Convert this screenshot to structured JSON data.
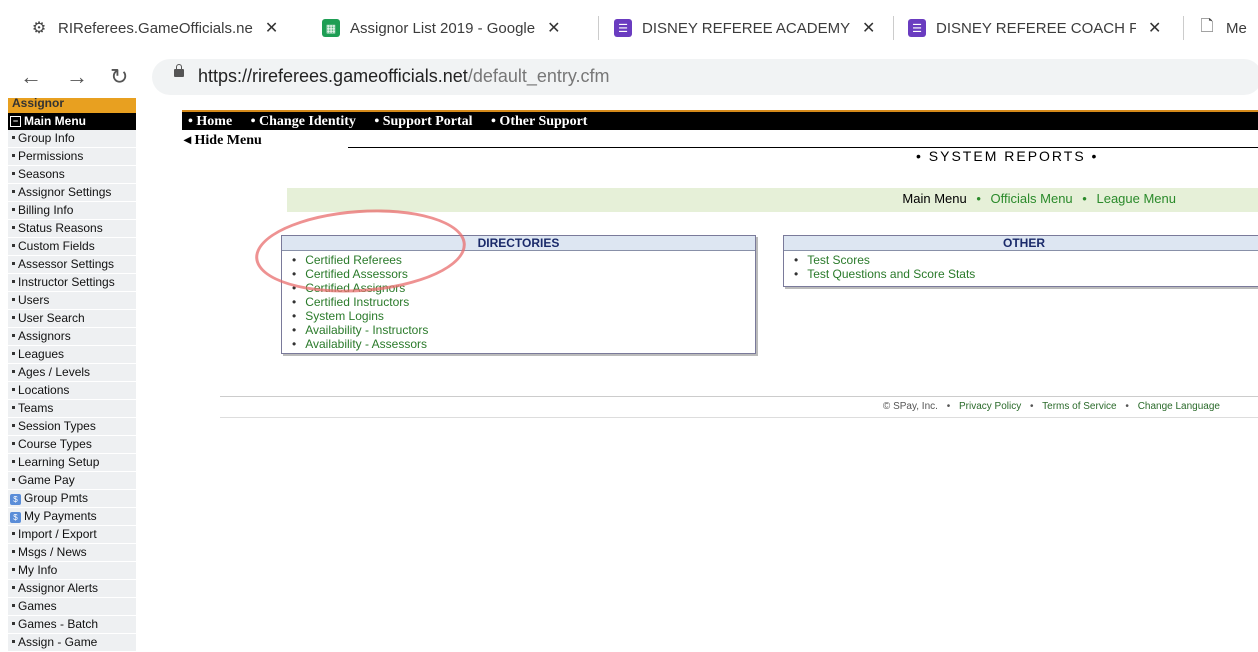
{
  "tabs": [
    {
      "title": "RIReferees.GameOfficials.ne",
      "icon": "gear-icon"
    },
    {
      "title": "Assignor List 2019 - Google",
      "icon": "sheets-icon"
    },
    {
      "title": "DISNEY REFEREE ACADEMY",
      "icon": "forms-icon"
    },
    {
      "title": "DISNEY REFEREE COACH FE",
      "icon": "forms-icon"
    },
    {
      "title": "Me",
      "icon": "page-icon"
    }
  ],
  "address": {
    "host": "https://rireferees.gameofficials.net",
    "path": "/default_entry.cfm"
  },
  "sidebar": {
    "assignor_header": "Assignor",
    "main_menu_header": "Main Menu",
    "items": [
      "Group Info",
      "Permissions",
      "Seasons",
      "Assignor Settings",
      "Billing Info",
      "Status Reasons",
      "Custom Fields",
      "Assessor Settings",
      "Instructor Settings",
      "Users",
      "User Search",
      "Assignors",
      "Leagues",
      "Ages / Levels",
      "Locations",
      "Teams",
      "Session Types",
      "Course Types",
      "Learning Setup",
      "Game Pay",
      "Group Pmts",
      "My Payments",
      "Import / Export",
      "Msgs / News",
      "My Info",
      "Assignor Alerts",
      "Games",
      "Games - Batch",
      "Assign - Game"
    ]
  },
  "topmenu": [
    "• Home",
    "• Change Identity",
    "• Support Portal",
    "• Other Support"
  ],
  "hide_menu": "◂ Hide Menu",
  "system_reports": "• SYSTEM REPORTS •",
  "mini_menu": {
    "current": "Main Menu",
    "links": [
      "Officials Menu",
      "League Menu"
    ]
  },
  "directories": {
    "title": "DIRECTORIES",
    "items": [
      "Certified Referees",
      "Certified Assessors",
      "Certified Assignors",
      "Certified Instructors",
      "System Logins",
      "Availability - Instructors",
      "Availability - Assessors"
    ]
  },
  "other": {
    "title": "OTHER",
    "items": [
      "Test Scores",
      "Test Questions and Score Stats"
    ]
  },
  "footer": {
    "copyright": "© SPay, Inc.",
    "links": [
      "Privacy Policy",
      "Terms of Service",
      "Change Language"
    ]
  }
}
